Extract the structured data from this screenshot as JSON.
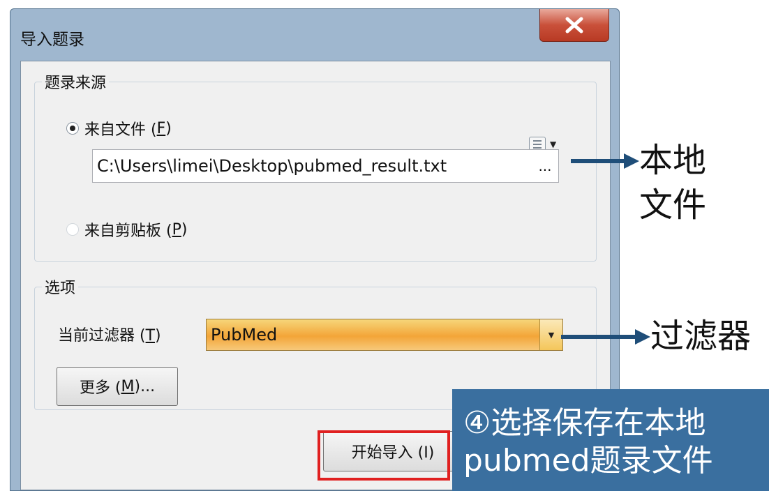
{
  "window": {
    "title": "导入题录",
    "close_label": "X"
  },
  "source_group": {
    "label": "题录来源",
    "from_file": {
      "label": "来自文件 (",
      "hotkey": "F",
      "suffix": ")"
    },
    "file_path": "C:\\Users\\limei\\Desktop\\pubmed_result.txt",
    "browse_label": "...",
    "from_clipboard": {
      "label": "来自剪贴板 (",
      "hotkey": "P",
      "suffix": ")"
    }
  },
  "options_group": {
    "label": "选项",
    "filter_label": "当前过滤器 (",
    "filter_hotkey": "T",
    "filter_suffix": ")",
    "filter_value": "PubMed",
    "more": {
      "label": "更多 (",
      "hotkey": "M",
      "suffix": ")..."
    }
  },
  "start_button": "开始导入 (I)",
  "annotations": {
    "local_file_line1": "本地",
    "local_file_line2": "文件",
    "filter": "过滤器",
    "banner_line1": "④选择保存在本地",
    "banner_line2": "pubmed题录文件"
  },
  "colors": {
    "banner": "#3a6f9f",
    "arrow": "#1f4e79",
    "highlight": "#e02020",
    "filter_orange": "#f3a538"
  }
}
